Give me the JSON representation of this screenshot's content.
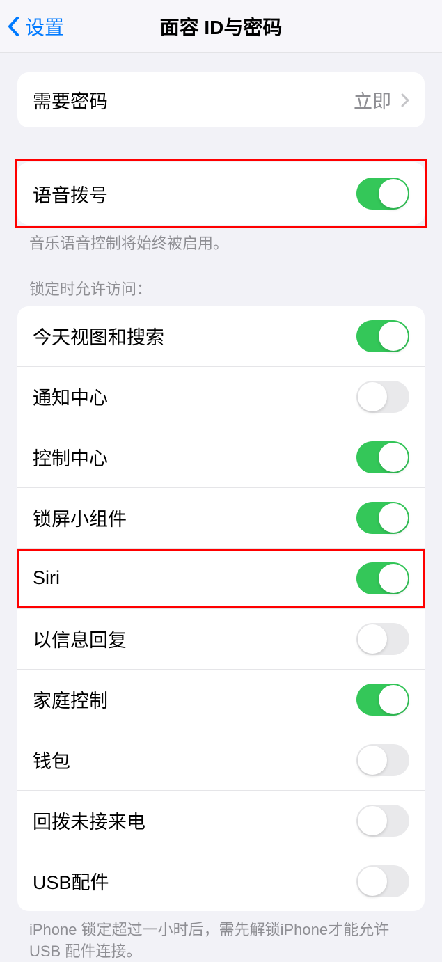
{
  "header": {
    "back_label": "设置",
    "title": "面容 ID与密码"
  },
  "require_passcode": {
    "label": "需要密码",
    "value": "立即"
  },
  "voice_dial": {
    "label": "语音拨号",
    "enabled": true,
    "footer": "音乐语音控制将始终被启用。"
  },
  "locked_access": {
    "header": "锁定时允许访问：",
    "items": [
      {
        "label": "今天视图和搜索",
        "enabled": true
      },
      {
        "label": "通知中心",
        "enabled": false
      },
      {
        "label": "控制中心",
        "enabled": true
      },
      {
        "label": "锁屏小组件",
        "enabled": true
      },
      {
        "label": "Siri",
        "enabled": true
      },
      {
        "label": "以信息回复",
        "enabled": false
      },
      {
        "label": "家庭控制",
        "enabled": true
      },
      {
        "label": "钱包",
        "enabled": false
      },
      {
        "label": "回拨未接来电",
        "enabled": false
      },
      {
        "label": "USB配件",
        "enabled": false
      }
    ],
    "footer": "iPhone 锁定超过一小时后，需先解锁iPhone才能允许USB 配件连接。"
  }
}
